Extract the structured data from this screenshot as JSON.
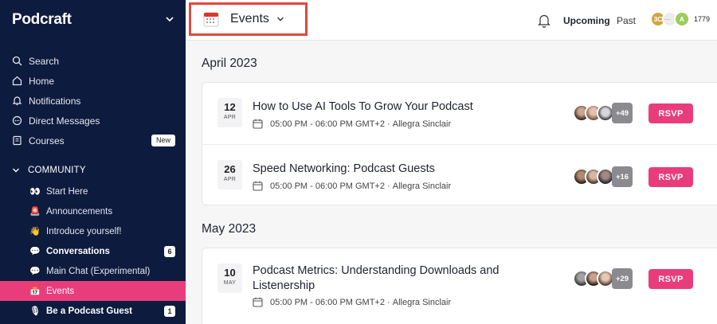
{
  "brand": {
    "name": "Podcraft"
  },
  "nav": [
    {
      "label": "Search",
      "icon": "search-icon"
    },
    {
      "label": "Home",
      "icon": "home-icon"
    },
    {
      "label": "Notifications",
      "icon": "bell-icon"
    },
    {
      "label": "Direct Messages",
      "icon": "chat-bubble-icon"
    },
    {
      "label": "Courses",
      "icon": "book-icon",
      "badge": "New"
    }
  ],
  "community": {
    "heading": "COMMUNITY",
    "items": [
      {
        "label": "Start Here",
        "emoji": "👀",
        "icon": "eyes-icon"
      },
      {
        "label": "Announcements",
        "emoji": "🚨",
        "icon": "siren-icon"
      },
      {
        "label": "Introduce yourself!",
        "emoji": "👋",
        "icon": "wave-icon"
      },
      {
        "label": "Conversations",
        "emoji": "💬",
        "icon": "speech-icon",
        "count": "6",
        "bold": true
      },
      {
        "label": "Main Chat (Experimental)",
        "emoji": "💬",
        "icon": "speech-icon"
      },
      {
        "label": "Events",
        "emoji": "📅",
        "icon": "calendar-icon",
        "active": true
      },
      {
        "label": "Be a Podcast Guest",
        "emoji": "🎙",
        "icon": "microphone-icon",
        "count": "1",
        "bold": true
      }
    ]
  },
  "header": {
    "title": "Events",
    "tabs": {
      "upcoming": "Upcoming",
      "past": "Past"
    },
    "members": {
      "avatars": [
        {
          "text": "3C",
          "color": "#d4a63a"
        },
        {
          "text": "",
          "color": "#e8e8e8"
        },
        {
          "text": "A",
          "color": "#9ccc5a"
        }
      ],
      "count": "1779"
    }
  },
  "months": [
    {
      "label": "April 2023",
      "events": [
        {
          "day": "12",
          "month": "APR",
          "title": "How to Use AI Tools To Grow Your Podcast",
          "time": "05:00 PM - 06:00 PM GMT+2",
          "host": "Allegra Sinclair",
          "more": "+49",
          "rsvp": "RSVP"
        },
        {
          "day": "26",
          "month": "APR",
          "title": "Speed Networking: Podcast Guests",
          "time": "05:00 PM - 06:00 PM GMT+2",
          "host": "Allegra Sinclair",
          "more": "+16",
          "rsvp": "RSVP"
        }
      ]
    },
    {
      "label": "May 2023",
      "events": [
        {
          "day": "10",
          "month": "MAY",
          "title": "Podcast Metrics: Understanding Downloads and Listenership",
          "time": "05:00 PM - 06:00 PM GMT+2",
          "host": "Allegra Sinclair",
          "more": "+29",
          "rsvp": "RSVP"
        }
      ]
    }
  ],
  "colors": {
    "sidebar_bg": "#0d1b3e",
    "accent": "#e93d7b",
    "highlight_border": "#e4473f"
  }
}
